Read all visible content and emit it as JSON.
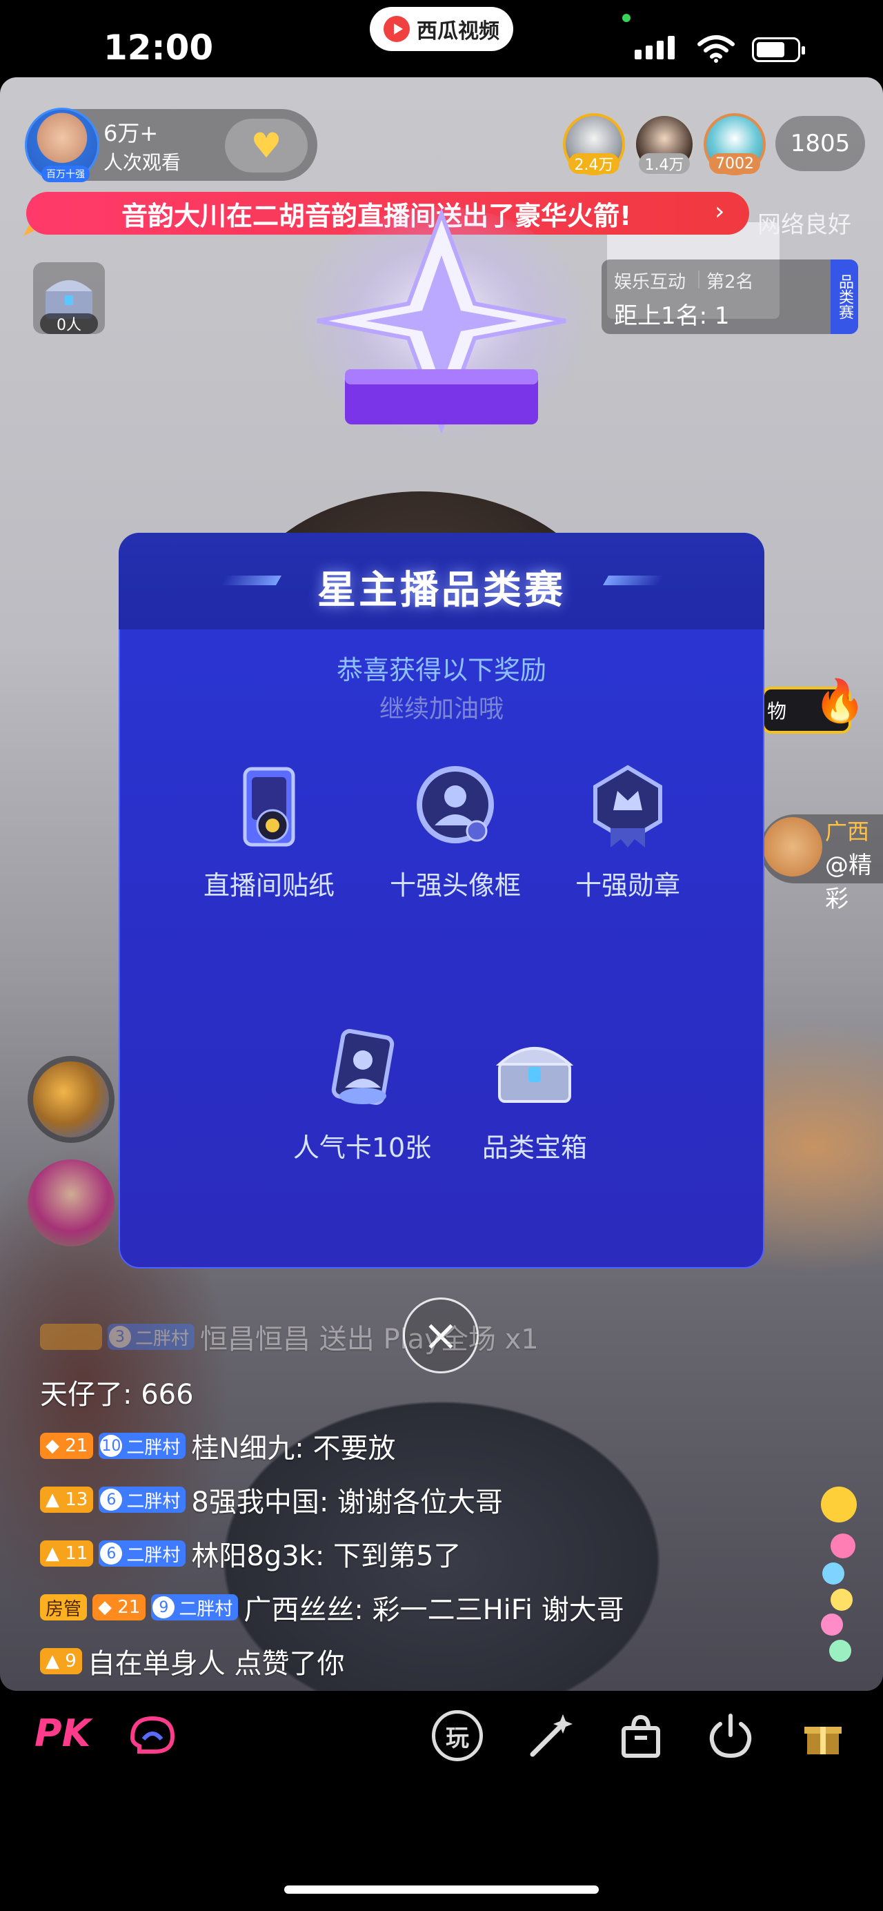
{
  "status_bar": {
    "time": "12:00",
    "app_name": "西瓜视频"
  },
  "host": {
    "viewers": "6万+",
    "viewers_label": "人次观看",
    "avatar_tag": "百万十强"
  },
  "top_viewers": [
    {
      "badge": "2.4万",
      "color": "#f4b21a"
    },
    {
      "badge": "1.4万",
      "color": "#b8b8b8"
    },
    {
      "badge": "7002",
      "color": "#e38b4a"
    }
  ],
  "online_count": "1805",
  "gift_banner": {
    "text": "音韵大川在二胡音韵直播间送出了豪华火箭!",
    "arrow": "›"
  },
  "network_status": "网络良好",
  "chest": {
    "count": "0人"
  },
  "rank": {
    "category": "娱乐互动",
    "place": "第2名",
    "gap": "距上1名: 1",
    "side_label": "品类赛"
  },
  "right_peek": {
    "gift_text": "物",
    "user_name": "广西",
    "user_at": "@精彩"
  },
  "modal": {
    "title": "星主播品类赛",
    "subtitle": "恭喜获得以下奖励",
    "subtitle2": "继续加油哦",
    "rewards": [
      {
        "label": "直播间贴纸",
        "icon": "sticker-icon"
      },
      {
        "label": "十强头像框",
        "icon": "avatar-frame-icon"
      },
      {
        "label": "十强勋章",
        "icon": "medal-icon"
      },
      {
        "label": "人气卡10张",
        "icon": "popularity-card-icon"
      },
      {
        "label": "品类宝箱",
        "icon": "treasure-chest-icon"
      }
    ]
  },
  "chat": [
    {
      "level": "",
      "fan_level": "3",
      "fan_club": "二胖村",
      "text": "恒昌恒昌 送出 Play全场 x1",
      "faded": true
    },
    {
      "text": "天仔了: 666"
    },
    {
      "level": "21",
      "fan_level": "10",
      "fan_club": "二胖村",
      "text": "桂N细九: 不要放"
    },
    {
      "level": "13",
      "fan_level": "6",
      "fan_club": "二胖村",
      "text": "8强我中国: 谢谢各位大哥"
    },
    {
      "level": "11",
      "fan_level": "6",
      "fan_club": "二胖村",
      "text": "林阳8g3k: 下到第5了"
    },
    {
      "admin": "房管",
      "level": "21",
      "fan_level": "9",
      "fan_club": "二胖村",
      "text": "广西丝丝: 彩一二三HiFi 谢大哥"
    },
    {
      "level": "9",
      "text": "自在单身人 点赞了你"
    }
  ],
  "bottom_bar": {
    "pk_label": "PK",
    "tools": [
      "chat-bubble-icon",
      "play-icon",
      "magic-wand-icon",
      "shopping-bag-icon",
      "power-icon",
      "gift-hand-icon"
    ],
    "play_label": "玩"
  }
}
